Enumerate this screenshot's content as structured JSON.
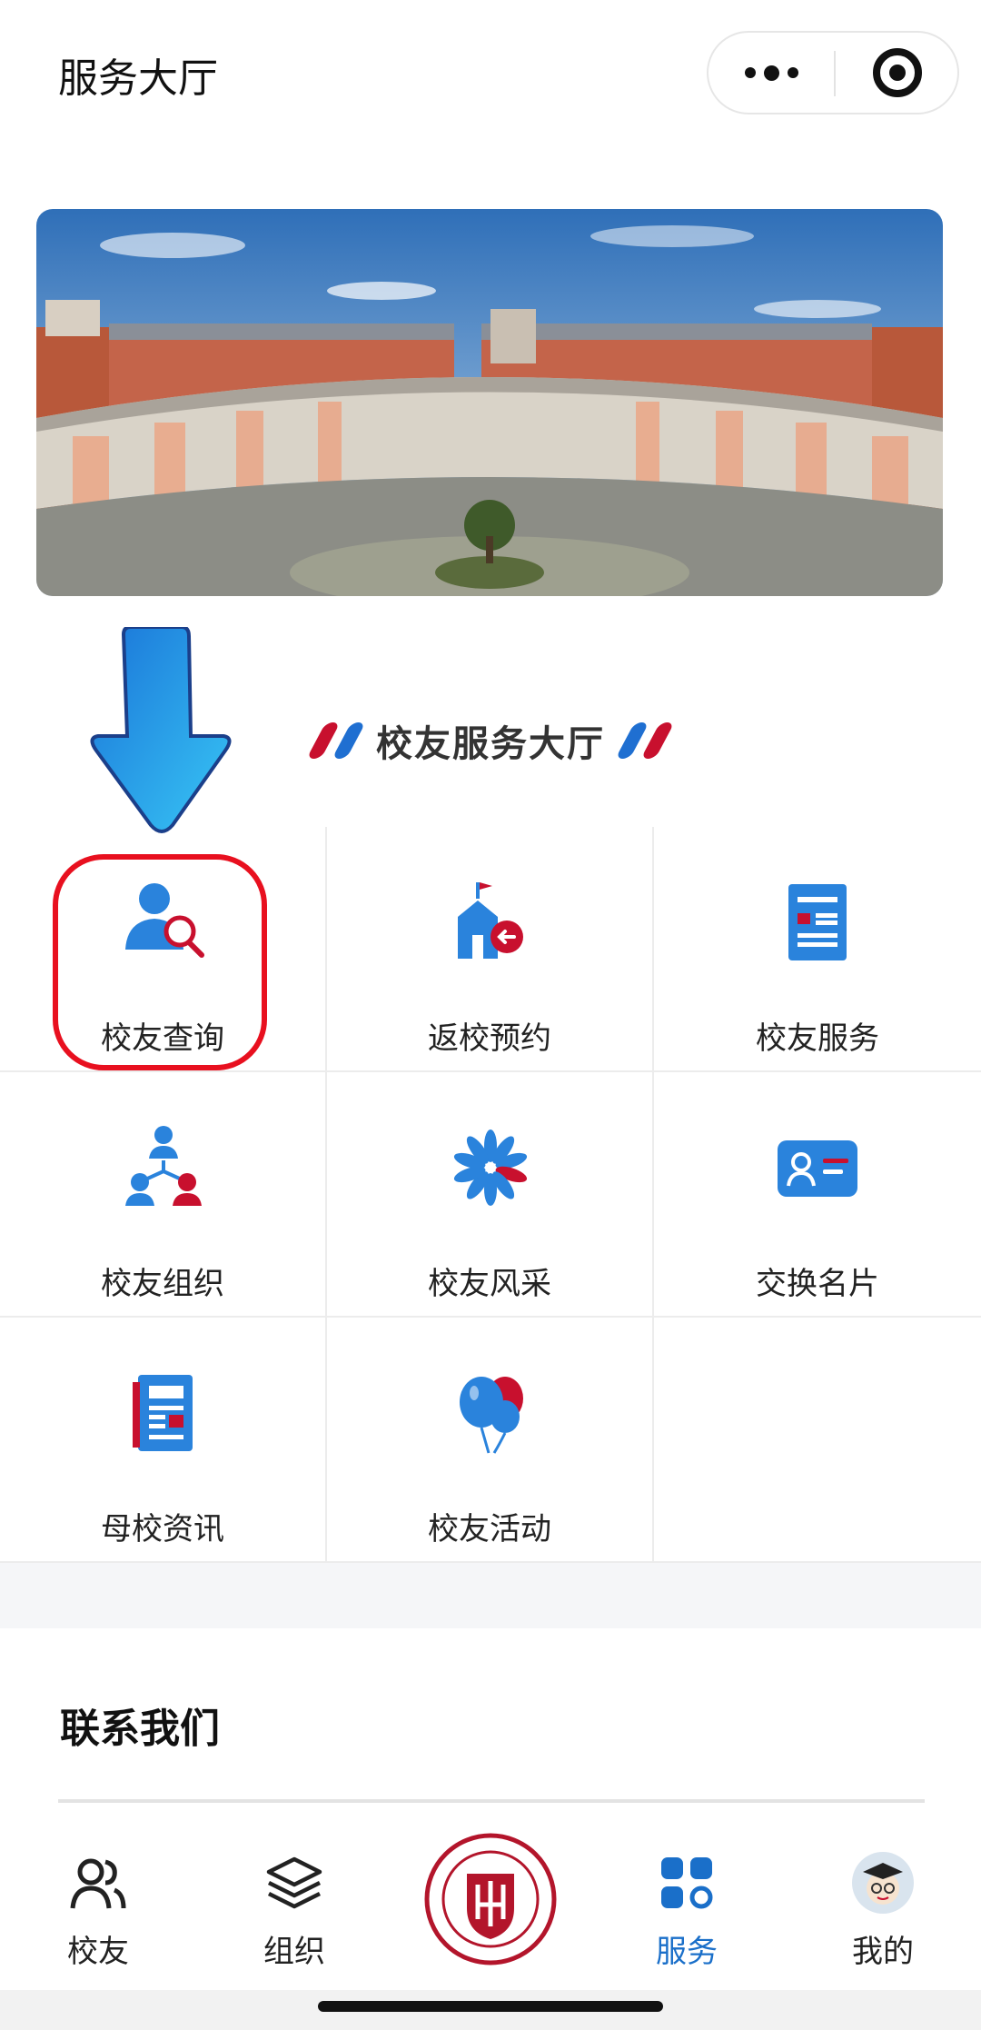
{
  "nav": {
    "title": "服务大厅"
  },
  "section": {
    "title": "校友服务大厅"
  },
  "services": [
    {
      "label": "校友查询",
      "icon": "alumni-search-icon"
    },
    {
      "label": "返校预约",
      "icon": "return-campus-icon"
    },
    {
      "label": "校友服务",
      "icon": "service-document-icon"
    },
    {
      "label": "校友组织",
      "icon": "organization-icon"
    },
    {
      "label": "校友风采",
      "icon": "pinwheel-icon"
    },
    {
      "label": "交换名片",
      "icon": "business-card-icon"
    },
    {
      "label": "母校资讯",
      "icon": "news-icon"
    },
    {
      "label": "校友活动",
      "icon": "balloons-icon"
    }
  ],
  "contact": {
    "title": "联系我们"
  },
  "tabbar": {
    "items": [
      {
        "label": "校友",
        "icon": "alumni-people-icon"
      },
      {
        "label": "组织",
        "icon": "layers-icon"
      },
      {
        "label": "",
        "icon": "university-logo-icon"
      },
      {
        "label": "服务",
        "icon": "grid-apps-icon"
      },
      {
        "label": "我的",
        "icon": "avatar-icon"
      }
    ],
    "active": "服务"
  },
  "colors": {
    "accent_blue": "#1a6fc9",
    "accent_red": "#c8102e",
    "highlight": "#e8101f"
  }
}
